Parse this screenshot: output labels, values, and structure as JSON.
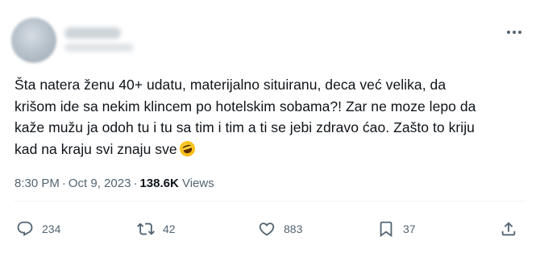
{
  "tweet": {
    "text_lines": [
      "Šta natera ženu 40+ udatu, materijalno situiranu, deca već velika, da",
      "krišom ide sa nekim klincem po hotelskim sobama?! Zar ne moze lepo da",
      "kaže mužu ja odoh tu i tu sa tim i tim a ti se jebi zdravo ćao. Zašto to kriju",
      "kad na kraju svi znaju sve"
    ],
    "emoji": "rolling-on-the-floor-laughing",
    "time": "8:30 PM",
    "separator": "·",
    "date": "Oct 9, 2023",
    "views_count": "138.6K",
    "views_label": "Views"
  },
  "actions": {
    "replies": "234",
    "retweets": "42",
    "likes": "883",
    "bookmarks": "37"
  },
  "icons": {
    "reply": "reply-icon",
    "retweet": "retweet-icon",
    "like": "heart-icon",
    "bookmark": "bookmark-icon",
    "share": "share-icon",
    "more": "more-icon"
  },
  "colors": {
    "text": "#0f1419",
    "secondary": "#536471",
    "divider": "#eff3f4"
  }
}
